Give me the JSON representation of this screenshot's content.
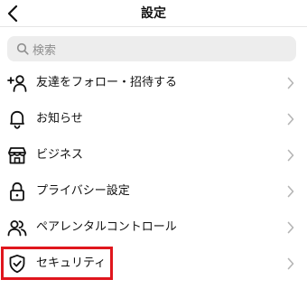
{
  "header": {
    "title": "設定",
    "back_icon": "chevron-left-icon"
  },
  "search": {
    "placeholder": "検索",
    "icon": "search-icon"
  },
  "menu": {
    "items": [
      {
        "label": "友達をフォロー・招待する",
        "icon": "add-person-icon"
      },
      {
        "label": "お知らせ",
        "icon": "bell-icon"
      },
      {
        "label": "ビジネス",
        "icon": "shop-icon"
      },
      {
        "label": "プライバシー設定",
        "icon": "lock-icon"
      },
      {
        "label": "ペアレンタルコントロール",
        "icon": "people-icon"
      },
      {
        "label": "セキュリティ",
        "icon": "shield-check-icon"
      }
    ]
  },
  "colors": {
    "highlight": "#e0161d",
    "search_bg": "#ededed",
    "chevron": "#b5b5b5"
  }
}
